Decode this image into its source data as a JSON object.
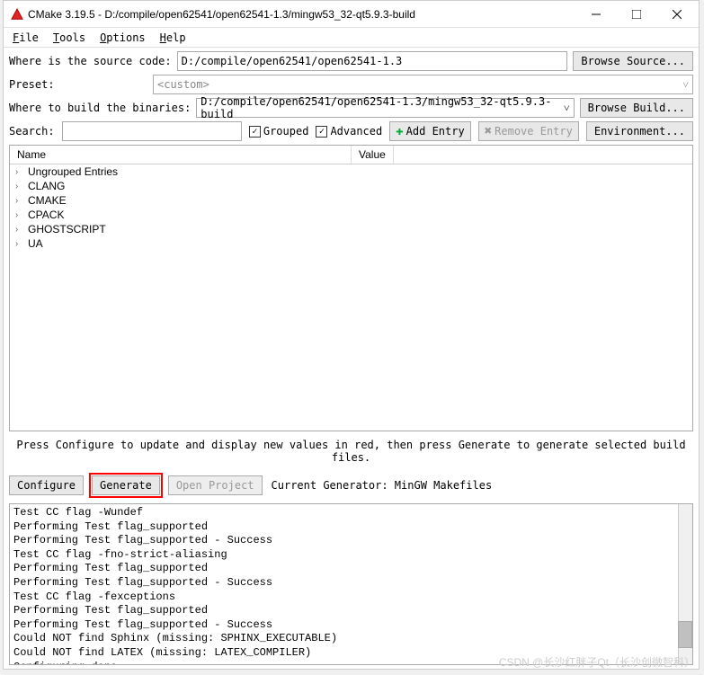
{
  "titlebar": {
    "text": "CMake 3.19.5 - D:/compile/open62541/open62541-1.3/mingw53_32-qt5.9.3-build"
  },
  "menu": {
    "file": "File",
    "tools": "Tools",
    "options": "Options",
    "help": "Help"
  },
  "labels": {
    "source": "Where is the source code:",
    "preset": "Preset:",
    "build": "Where to build the binaries:",
    "search": "Search:"
  },
  "fields": {
    "source": "D:/compile/open62541/open62541-1.3",
    "preset": "<custom>",
    "build": "D:/compile/open62541/open62541-1.3/mingw53_32-qt5.9.3-build",
    "search": ""
  },
  "buttons": {
    "browse_source": "Browse Source...",
    "browse_build": "Browse Build...",
    "add_entry": "Add Entry",
    "remove_entry": "Remove Entry",
    "environment": "Environment...",
    "configure": "Configure",
    "generate": "Generate",
    "open_project": "Open Project"
  },
  "checkboxes": {
    "grouped": "Grouped",
    "advanced": "Advanced"
  },
  "tree": {
    "headers": {
      "name": "Name",
      "value": "Value"
    },
    "items": [
      "Ungrouped Entries",
      "CLANG",
      "CMAKE",
      "CPACK",
      "GHOSTSCRIPT",
      "UA"
    ]
  },
  "hint": "Press Configure to update and display new values in red, then press Generate to generate selected build files.",
  "generator_text": "Current Generator: MinGW Makefiles",
  "output_lines": [
    "Test CC flag -Wundef",
    "Performing Test flag_supported",
    "Performing Test flag_supported - Success",
    "Test CC flag -fno-strict-aliasing",
    "Performing Test flag_supported",
    "Performing Test flag_supported - Success",
    "Test CC flag -fexceptions",
    "Performing Test flag_supported",
    "Performing Test flag_supported - Success",
    "Could NOT find Sphinx (missing: SPHINX_EXECUTABLE)",
    "Could NOT find LATEX (missing: LATEX_COMPILER)",
    "Configuring done"
  ],
  "watermark": "CSDN @长沙红胖子Qt（长沙创微智科）"
}
